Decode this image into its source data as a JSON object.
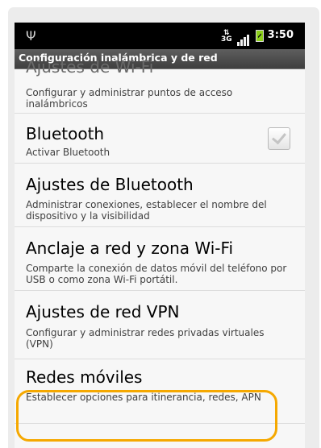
{
  "status_bar": {
    "usb_icon": "usb-debug-icon",
    "network_type": "3G",
    "time": "3:50",
    "battery_color": "#8ccf1a"
  },
  "title": "Configuración inalámbrica y de red",
  "items": [
    {
      "title": "Ajustes de Wi-Fi",
      "subtitle": "Configurar y administrar puntos de acceso inalámbricos",
      "partially_hidden": true
    },
    {
      "title": "Bluetooth",
      "subtitle": "Activar Bluetooth",
      "has_checkbox": true,
      "checked": true
    },
    {
      "title": "Ajustes de Bluetooth",
      "subtitle": "Administrar conexiones, establecer el nombre del dispositivo y la visibilidad"
    },
    {
      "title": "Anclaje a red y zona Wi-Fi",
      "subtitle": "Comparte la conexión de datos móvil del teléfono por USB o como zona Wi-Fi portátil."
    },
    {
      "title": "Ajustes de red VPN",
      "subtitle": "Configurar y administrar redes privadas virtuales (VPN)"
    },
    {
      "title": "Redes móviles",
      "subtitle": "Establecer opciones para itinerancia, redes, APN",
      "highlighted": true
    }
  ],
  "highlight_color": "#f5a800"
}
